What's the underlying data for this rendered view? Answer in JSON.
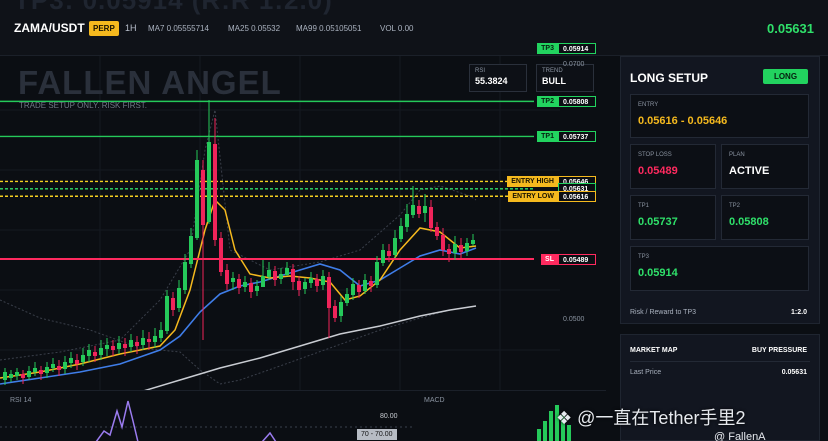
{
  "topbar": {
    "ghost_title": "TP3: 0.05914 (R:R 1:2.0)",
    "pair": "ZAMA/USDT",
    "badge": "PERP",
    "timeframe": "1H",
    "ma7": "MA7 0.05555714",
    "ma25": "MA25 0.05532",
    "ma99": "MA99 0.05105051",
    "vol": "VOL 0.00",
    "last_price": "0.05631"
  },
  "chart": {
    "brand": "FALLEN ANGEL",
    "tagline": "TRADE SETUP ONLY. RISK FIRST.",
    "rsi_box": {
      "label": "RSI",
      "value": "55.3824"
    },
    "trend_box": {
      "label": "TREND",
      "value": "BULL"
    },
    "axis_top": "0.0700",
    "axis_mid": "0.0500",
    "levels": [
      {
        "key": "tp3",
        "name": "TP3",
        "price": "0.05914",
        "value": 0.05914,
        "line_color": "#25c95a",
        "tag_bg": "#22d35f",
        "tag_fg": "#06200f",
        "dashed": false
      },
      {
        "key": "tp2",
        "name": "TP2",
        "price": "0.05808",
        "value": 0.05808,
        "line_color": "#25c95a",
        "tag_bg": "#22d35f",
        "tag_fg": "#06200f",
        "dashed": false
      },
      {
        "key": "tp1",
        "name": "TP1",
        "price": "0.05737",
        "value": 0.05737,
        "line_color": "#25c95a",
        "tag_bg": "#22d35f",
        "tag_fg": "#06200f",
        "dashed": false
      },
      {
        "key": "entry_high",
        "name": "ENTRY HIGH",
        "price": "0.05646",
        "value": 0.05646,
        "line_color": "#f5d020",
        "tag_bg": "#f5b91e",
        "tag_fg": "#1a1400",
        "dashed": true
      },
      {
        "key": "last",
        "name": "",
        "price": "0.05631",
        "value": 0.05631,
        "line_color": "#2fe06a",
        "tag_bg": "#22d35f",
        "tag_fg": "#06200f",
        "dashed": true
      },
      {
        "key": "entry_low",
        "name": "ENTRY LOW",
        "price": "0.05616",
        "value": 0.05616,
        "line_color": "#f5d020",
        "tag_bg": "#f5b91e",
        "tag_fg": "#1a1400",
        "dashed": true
      },
      {
        "key": "sl",
        "name": "SL",
        "price": "0.05489",
        "value": 0.05489,
        "line_color": "#ff2a5f",
        "tag_bg": "#ff2a5f",
        "tag_fg": "#ffffff",
        "dashed": false
      }
    ]
  },
  "rsi_pane": {
    "label": "RSI 14",
    "level_80": "80.00",
    "tag_70": "70 - 70.00"
  },
  "macd_pane": {
    "label": "MACD"
  },
  "setup": {
    "title": "LONG SETUP",
    "badge": "LONG",
    "entry": {
      "label": "ENTRY",
      "value": "0.05616 - 0.05646",
      "color": "#f5b91e"
    },
    "stop_loss": {
      "label": "STOP LOSS",
      "value": "0.05489",
      "color": "#ff2a5f"
    },
    "plan": {
      "label": "PLAN",
      "value": "ACTIVE",
      "color": "#ffffff"
    },
    "tp1": {
      "label": "TP1",
      "value": "0.05737",
      "color": "#2fe06a"
    },
    "tp2": {
      "label": "TP2",
      "value": "0.05808",
      "color": "#2fe06a"
    },
    "tp3": {
      "label": "TP3",
      "value": "0.05914",
      "color": "#2fe06a"
    },
    "rr_label": "Risk / Reward to TP3",
    "rr_value": "1:2.0"
  },
  "market_map": {
    "title": "MARKET MAP",
    "pressure": "BUY PRESSURE",
    "last_price_label": "Last Price",
    "last_price_value": "0.05631"
  },
  "watermark": {
    "text": "@一直在Tether手里2",
    "sub": "@ FallenA"
  },
  "colors": {
    "bull": "#25c95a",
    "bear": "#f0245a",
    "ma7": "#f5b91e",
    "ma25": "#3f7de8",
    "ma99": "#c9ccd2",
    "accent_green": "#22d35f"
  },
  "icons": {
    "watermark": "diamond-logo-icon"
  }
}
